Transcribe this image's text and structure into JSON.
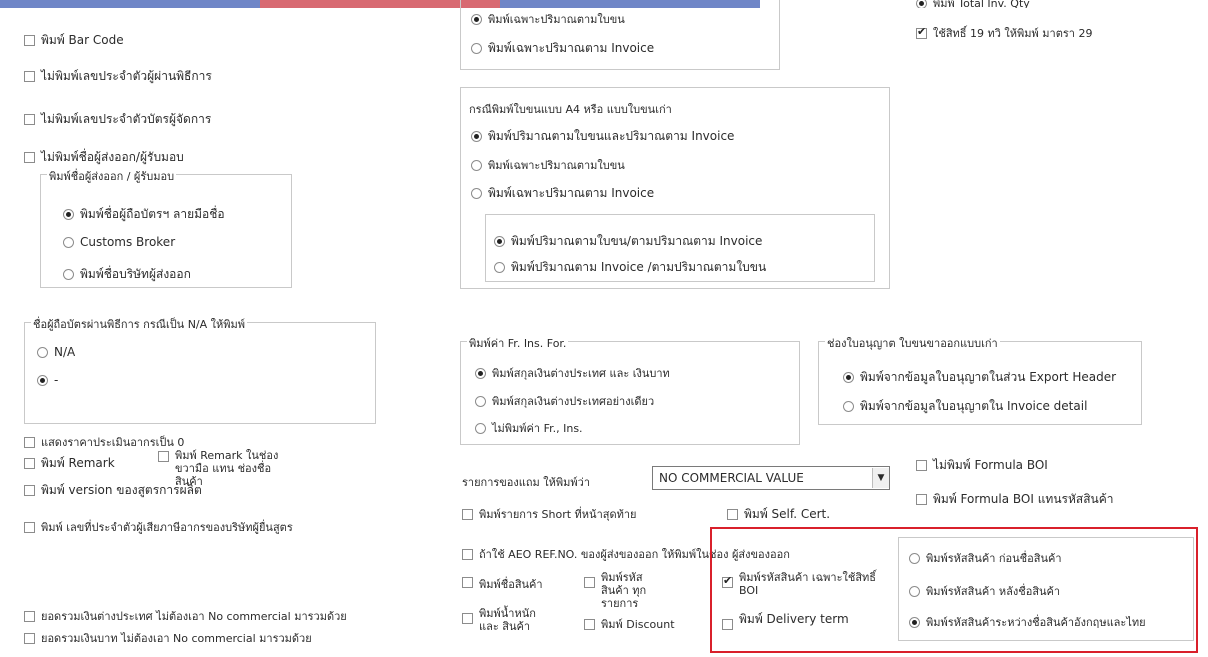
{
  "left": {
    "bar_code": "พิมพ์ Bar Code",
    "no_exporter_id": "ไม่พิมพ์เลขประจำตัวผู้ผ่านพิธีการ",
    "no_card_id": "ไม่พิมพ์เลขประจำตัวบัตรผู้จัดการ",
    "no_sender_name": "ไม่พิมพ์ชื่อผู้ส่งออก/ผู้รับมอบ",
    "sender_group": {
      "title": "พิมพ์ชื่อผู้ส่งออก / ผู้รับมอบ",
      "opt1": "พิมพ์ชื่อผู้ถือบัตรฯ ลายมือชื่อ",
      "opt2": "Customs Broker",
      "opt3": "พิมพ์ชื่อบริษัทผู้ส่งออก"
    },
    "na_group": {
      "title": "ชื่อผู้ถือบัตรผ่านพิธีการ กรณีเป็น N/A ให้พิมพ์",
      "opt1": "N/A",
      "opt2": "-"
    },
    "zero_price": "แสดงราคาประเมินอากรเป็น 0",
    "remark": "พิมพ์ Remark",
    "remark_box": "พิมพ์ Remark ในช่องขวามือ แทน ช่องชื่อสินค้า",
    "version": "พิมพ์ version ของสูตรการผลิต",
    "tax_id": "พิมพ์ เลขที่ประจำตัวผู้เสียภาษีอากรของบริษัทผู้ยื่นสูตร",
    "foreign_sum": "ยอดรวมเงินต่างประเทศ ไม่ต้องเอา No commercial มารวมด้วย",
    "baht_sum": "ยอดรวมเงินบาท ไม่ต้องเอา No commercial มารวมด้วย"
  },
  "mid": {
    "top_group": {
      "opt1": "พิมพ์เฉพาะปริมาณตามใบขน",
      "opt2": "พิมพ์เฉพาะปริมาณตาม Invoice"
    },
    "a4_group": {
      "title": "กรณีพิมพ์ใบขนแบบ A4 หรือ แบบใบขนเก่า",
      "opt1": "พิมพ์ปริมาณตามใบขนและปริมาณตาม Invoice",
      "opt2": "พิมพ์เฉพาะปริมาณตามใบขน",
      "opt3": "พิมพ์เฉพาะปริมาณตาม Invoice",
      "inner1": "พิมพ์ปริมาณตามใบขน/ตามปริมาณตาม Invoice",
      "inner2": "พิมพ์ปริมาณตาม Invoice /ตามปริมาณตามใบขน"
    },
    "fr_group": {
      "title": "พิมพ์ค่า Fr. Ins. For.",
      "opt1": "พิมพ์สกุลเงินต่างประเทศ และ เงินบาท",
      "opt2": "พิมพ์สกุลเงินต่างประเทศอย่างเดียว",
      "opt3": "ไม่พิมพ์ค่า Fr., Ins."
    },
    "no_value_label": "รายการของแถม ให้พิมพ์ว่า",
    "no_value_select": "NO COMMERCIAL VALUE",
    "short_last": "พิมพ์รายการ Short ที่หน้าสุดท้าย",
    "self_cert": "พิมพ์ Self. Cert.",
    "aeo": "ถ้าใช้ AEO REF.NO. ของผู้ส่งของออก ให้พิมพ์ในช่อง ผู้ส่งของออก",
    "print_product": "พิมพ์ชื่อสินค้า",
    "print_code_all": "พิมพ์รหัสสินค้า ทุกรายการ",
    "print_weight": "พิมพ์น้ำหนักและ สินค้า",
    "discount": "พิมพ์ Discount",
    "code_boi": "พิมพ์รหัสสินค้า เฉพาะใช้สิทธิ์ BOI",
    "delivery": "พิมพ์ Delivery term"
  },
  "right": {
    "top_partial": "พิมพ์ Total Inv. Qty",
    "use19": "ใช้สิทธิ์ 19 ทวิ ให้พิมพ์ มาตรา 29",
    "license_group": {
      "title": "ช่องใบอนุญาต ใบขนขาออกแบบเก่า",
      "opt1": "พิมพ์จากข้อมูลใบอนุญาตในส่วน Export Header",
      "opt2": "พิมพ์จากข้อมูลใบอนุญาตใน Invoice detail"
    },
    "no_formula": "ไม่พิมพ์ Formula BOI",
    "formula_instead": "พิมพ์ Formula BOI แทนรหัสสินค้า",
    "code_group": {
      "opt1": "พิมพ์รหัสสินค้า ก่อนชื่อสินค้า",
      "opt2": "พิมพ์รหัสสินค้า หลังชื่อสินค้า",
      "opt3": "พิมพ์รหัสสินค้าระหว่างชื่อสินค้าอังกฤษและไทย"
    }
  },
  "colors": {
    "highlight": "#d9202b",
    "border": "#c9c9c9"
  }
}
